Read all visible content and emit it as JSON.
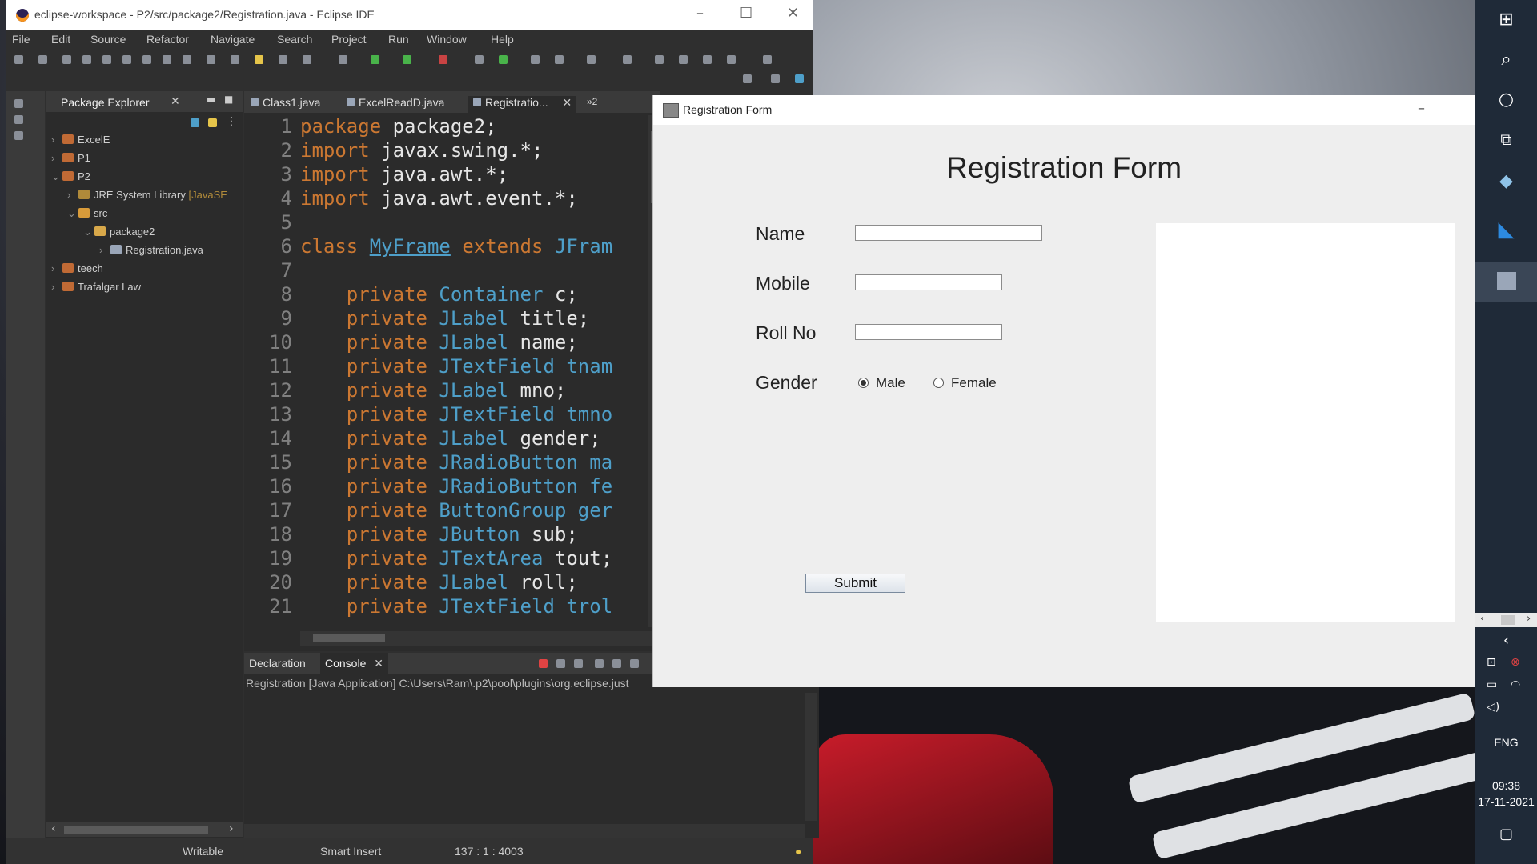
{
  "eclipse": {
    "title": "eclipse-workspace - P2/src/package2/Registration.java - Eclipse IDE",
    "menu": [
      "File",
      "Edit",
      "Source",
      "Refactor",
      "Navigate",
      "Search",
      "Project",
      "Run",
      "Window",
      "Help"
    ]
  },
  "package_explorer": {
    "tab_label": "Package Explorer",
    "tree": [
      {
        "label": "ExcelE"
      },
      {
        "label": "P1"
      },
      {
        "label": "P2"
      },
      {
        "label": "JRE System Library",
        "suffix": "[JavaSE"
      },
      {
        "label": "src"
      },
      {
        "label": "package2"
      },
      {
        "label": "Registration.java"
      },
      {
        "label": "teech"
      },
      {
        "label": "Trafalgar Law"
      }
    ]
  },
  "editor": {
    "tabs": [
      "Class1.java",
      "ExcelReadD.java",
      "Registratio...",
      "»2"
    ],
    "lines": [
      {
        "n": "1",
        "kw": "package",
        "rest": " package2;"
      },
      {
        "n": "2",
        "kw": "import",
        "rest": " javax.swing.*;"
      },
      {
        "n": "3",
        "kw": "import",
        "rest": " java.awt.*;"
      },
      {
        "n": "4",
        "kw": "import",
        "rest": " java.awt.event.*;"
      },
      {
        "n": "5",
        "kw": "",
        "rest": ""
      },
      {
        "n": "6",
        "kw": "class",
        "cls": "MyFrame",
        "kw2": "extends",
        "ty": "JFram"
      },
      {
        "n": "7",
        "kw": "",
        "rest": ""
      },
      {
        "n": "8",
        "kw": "private",
        "ty": "Container",
        "rest": " c;"
      },
      {
        "n": "9",
        "kw": "private",
        "ty": "JLabel",
        "rest": " title;"
      },
      {
        "n": "10",
        "kw": "private",
        "ty": "JLabel",
        "rest": " name;"
      },
      {
        "n": "11",
        "kw": "private",
        "ty": "JTextField",
        "rest": " tnam"
      },
      {
        "n": "12",
        "kw": "private",
        "ty": "JLabel",
        "rest": " mno;"
      },
      {
        "n": "13",
        "kw": "private",
        "ty": "JTextField",
        "rest": " tmno"
      },
      {
        "n": "14",
        "kw": "private",
        "ty": "JLabel",
        "rest": " gender;"
      },
      {
        "n": "15",
        "kw": "private",
        "ty": "JRadioButton",
        "rest": " ma"
      },
      {
        "n": "16",
        "kw": "private",
        "ty": "JRadioButton",
        "rest": " fe"
      },
      {
        "n": "17",
        "kw": "private",
        "ty": "ButtonGroup",
        "rest": " ger"
      },
      {
        "n": "18",
        "kw": "private",
        "ty": "JButton",
        "rest": " sub;"
      },
      {
        "n": "19",
        "kw": "private",
        "ty": "JTextArea",
        "rest": " tout;"
      },
      {
        "n": "20",
        "kw": "private",
        "ty": "JLabel",
        "rest": " roll;"
      },
      {
        "n": "21",
        "kw": "private",
        "ty": "JTextField",
        "rest": " trol"
      }
    ]
  },
  "console": {
    "tabs": [
      "Declaration",
      "Console"
    ],
    "path": "Registration [Java Application] C:\\Users\\Ram\\.p2\\pool\\plugins\\org.eclipse.just"
  },
  "statusbar": {
    "writable": "Writable",
    "insert": "Smart Insert",
    "position": "137 : 1 : 4003"
  },
  "form": {
    "window_title": "Registration Form",
    "heading": "Registration Form",
    "name_label": "Name",
    "name_value": "",
    "mobile_label": "Mobile",
    "mobile_value": "",
    "roll_label": "Roll No",
    "roll_value": "",
    "gender_label": "Gender",
    "male_label": "Male",
    "female_label": "Female",
    "selected_gender": "Male",
    "submit_label": "Submit",
    "output_text": ""
  },
  "taskbar": {
    "lang": "ENG",
    "time": "09:38",
    "date": "17-11-2021"
  },
  "colors": {
    "keyword": "#cc7832",
    "type": "#4e9fc9",
    "taskbar": "#1f2a38"
  }
}
